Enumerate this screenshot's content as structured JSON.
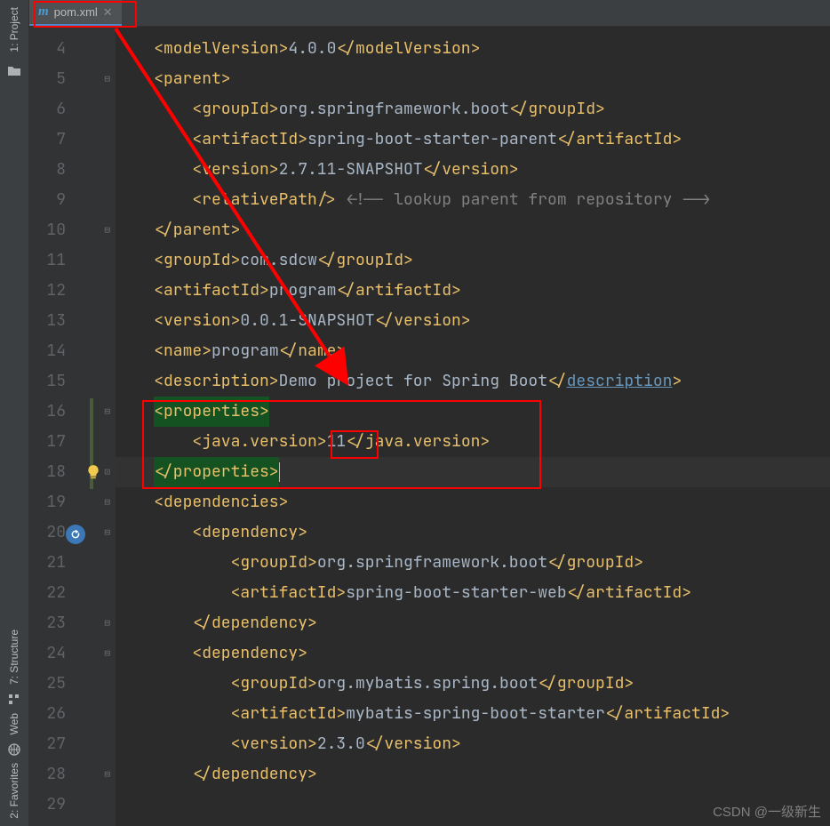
{
  "tab": {
    "filename": "pom.xml"
  },
  "sidebar": {
    "tabs": [
      "1: Project",
      "7: Structure",
      "Web",
      "2: Favorites"
    ]
  },
  "gutter": {
    "start": 4,
    "end": 29
  },
  "code": {
    "lines": [
      {
        "i": 1,
        "seg": [
          {
            "c": "t-tag",
            "t": "<modelVersion>"
          },
          {
            "c": "t-txt",
            "t": "4.0.0"
          },
          {
            "c": "t-tag",
            "t": "</modelVersion>"
          }
        ]
      },
      {
        "i": 1,
        "seg": [
          {
            "c": "t-tag",
            "t": "<parent>"
          }
        ]
      },
      {
        "i": 2,
        "seg": [
          {
            "c": "t-tag",
            "t": "<groupId>"
          },
          {
            "c": "t-txt",
            "t": "org.springframework.boot"
          },
          {
            "c": "t-tag",
            "t": "</groupId>"
          }
        ]
      },
      {
        "i": 2,
        "seg": [
          {
            "c": "t-tag",
            "t": "<artifactId>"
          },
          {
            "c": "t-txt",
            "t": "spring-boot-starter-parent"
          },
          {
            "c": "t-tag",
            "t": "</artifactId>"
          }
        ]
      },
      {
        "i": 2,
        "seg": [
          {
            "c": "t-tag",
            "t": "<version>"
          },
          {
            "c": "t-txt",
            "t": "2.7.11-SNAPSHOT"
          },
          {
            "c": "t-tag",
            "t": "</version>"
          }
        ]
      },
      {
        "i": 2,
        "seg": [
          {
            "c": "t-tag",
            "t": "<relativePath/>"
          },
          {
            "c": "t-txt",
            "t": " "
          },
          {
            "c": "t-cmt",
            "t": "<!-- lookup parent from repository -->"
          }
        ]
      },
      {
        "i": 1,
        "seg": [
          {
            "c": "t-tag",
            "t": "</parent>"
          }
        ]
      },
      {
        "i": 1,
        "seg": [
          {
            "c": "t-tag",
            "t": "<groupId>"
          },
          {
            "c": "t-txt",
            "t": "com.sdcw"
          },
          {
            "c": "t-tag",
            "t": "</groupId>"
          }
        ]
      },
      {
        "i": 1,
        "seg": [
          {
            "c": "t-tag",
            "t": "<artifactId>"
          },
          {
            "c": "t-txt",
            "t": "program"
          },
          {
            "c": "t-tag",
            "t": "</artifactId>"
          }
        ]
      },
      {
        "i": 1,
        "seg": [
          {
            "c": "t-tag",
            "t": "<version>"
          },
          {
            "c": "t-txt",
            "t": "0.0.1-SNAPSHOT"
          },
          {
            "c": "t-tag",
            "t": "</version>"
          }
        ]
      },
      {
        "i": 1,
        "seg": [
          {
            "c": "t-tag",
            "t": "<name>"
          },
          {
            "c": "t-txt",
            "t": "program"
          },
          {
            "c": "t-tag",
            "t": "</name>"
          }
        ]
      },
      {
        "i": 1,
        "seg": [
          {
            "c": "t-tag",
            "t": "<description>"
          },
          {
            "c": "t-txt",
            "t": "Demo project for Spring Boot"
          },
          {
            "c": "t-tag",
            "t": "</"
          },
          {
            "c": "t-lnk2",
            "t": "description"
          },
          {
            "c": "t-tag",
            "t": ">"
          }
        ]
      },
      {
        "i": 1,
        "hl": true,
        "seg": [
          {
            "c": "t-tag hl",
            "t": "<properties>"
          }
        ]
      },
      {
        "i": 2,
        "seg": [
          {
            "c": "t-tag",
            "t": "<java.version>"
          },
          {
            "c": "t-txt",
            "t": "11"
          },
          {
            "c": "t-tag",
            "t": "</java.version>"
          }
        ]
      },
      {
        "i": 1,
        "cl": true,
        "seg": [
          {
            "c": "t-tag hl",
            "t": "</properties>"
          },
          {
            "caret": true
          }
        ]
      },
      {
        "i": 1,
        "seg": [
          {
            "c": "t-tag",
            "t": "<dependencies>"
          }
        ]
      },
      {
        "i": 2,
        "seg": [
          {
            "c": "t-tag",
            "t": "<dependency>"
          }
        ]
      },
      {
        "i": 3,
        "seg": [
          {
            "c": "t-tag",
            "t": "<groupId>"
          },
          {
            "c": "t-txt",
            "t": "org.springframework.boot"
          },
          {
            "c": "t-tag",
            "t": "</groupId>"
          }
        ]
      },
      {
        "i": 3,
        "seg": [
          {
            "c": "t-tag",
            "t": "<artifactId>"
          },
          {
            "c": "t-txt",
            "t": "spring-boot-starter-web"
          },
          {
            "c": "t-tag",
            "t": "</artifactId>"
          }
        ]
      },
      {
        "i": 2,
        "seg": [
          {
            "c": "t-tag",
            "t": "</dependency>"
          }
        ]
      },
      {
        "i": 2,
        "seg": [
          {
            "c": "t-tag",
            "t": "<dependency>"
          }
        ]
      },
      {
        "i": 3,
        "seg": [
          {
            "c": "t-tag",
            "t": "<groupId>"
          },
          {
            "c": "t-txt",
            "t": "org.mybatis.spring.boot"
          },
          {
            "c": "t-tag",
            "t": "</groupId>"
          }
        ]
      },
      {
        "i": 3,
        "seg": [
          {
            "c": "t-tag",
            "t": "<artifactId>"
          },
          {
            "c": "t-txt",
            "t": "mybatis-spring-boot-starter"
          },
          {
            "c": "t-tag",
            "t": "</artifactId>"
          }
        ]
      },
      {
        "i": 3,
        "seg": [
          {
            "c": "t-tag",
            "t": "<version>"
          },
          {
            "c": "t-txt",
            "t": "2.3.0"
          },
          {
            "c": "t-tag",
            "t": "</version>"
          }
        ]
      },
      {
        "i": 2,
        "seg": [
          {
            "c": "t-tag",
            "t": "</dependency>"
          }
        ]
      },
      {
        "i": 0,
        "seg": []
      }
    ]
  },
  "watermark": "CSDN @一级新生"
}
